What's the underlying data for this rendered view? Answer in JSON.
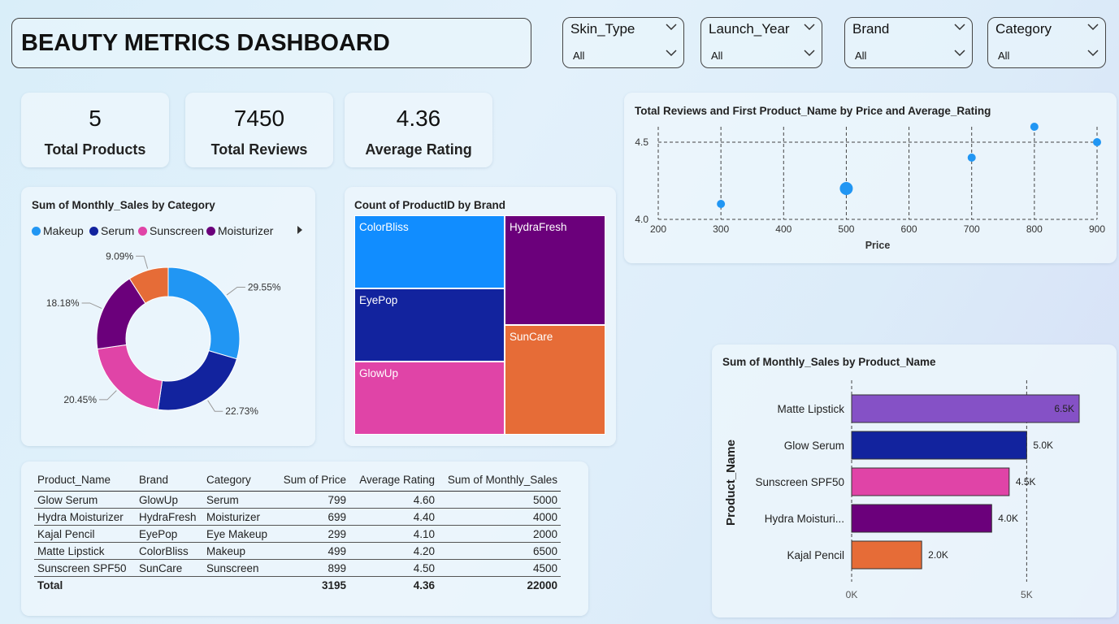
{
  "header": {
    "title": "BEAUTY METRICS DASHBOARD"
  },
  "slicers": [
    {
      "label": "Skin_Type",
      "value": "All"
    },
    {
      "label": "Launch_Year",
      "value": "All"
    },
    {
      "label": "Brand",
      "value": "All"
    },
    {
      "label": "Category",
      "value": "All"
    }
  ],
  "kpis": [
    {
      "value": "5",
      "caption": "Total Products"
    },
    {
      "value": "7450",
      "caption": "Total Reviews"
    },
    {
      "value": "4.36",
      "caption": "Average Rating"
    }
  ],
  "donut": {
    "title": "Sum of Monthly_Sales by Category"
  },
  "treemap": {
    "title": "Count of ProductID by Brand"
  },
  "scatter": {
    "title": "Total Reviews and First Product_Name by Price and Average_Rating"
  },
  "bars": {
    "title": "Sum of Monthly_Sales by Product_Name"
  },
  "table": {
    "columns": [
      "Product_Name",
      "Brand",
      "Category",
      "Sum of Price",
      "Average Rating",
      "Sum of Monthly_Sales"
    ],
    "rows": [
      [
        "Glow Serum",
        "GlowUp",
        "Serum",
        "799",
        "4.60",
        "5000"
      ],
      [
        "Hydra Moisturizer",
        "HydraFresh",
        "Moisturizer",
        "699",
        "4.40",
        "4000"
      ],
      [
        "Kajal Pencil",
        "EyePop",
        "Eye Makeup",
        "299",
        "4.10",
        "2000"
      ],
      [
        "Matte Lipstick",
        "ColorBliss",
        "Makeup",
        "499",
        "4.20",
        "6500"
      ],
      [
        "Sunscreen SPF50",
        "SunCare",
        "Sunscreen",
        "899",
        "4.50",
        "4500"
      ]
    ],
    "total": [
      "Total",
      "",
      "",
      "3195",
      "4.36",
      "22000"
    ]
  },
  "chart_data": [
    {
      "type": "pie",
      "title": "Sum of Monthly_Sales by Category",
      "legend_position": "top-left",
      "categories": [
        "Makeup",
        "Serum",
        "Sunscreen",
        "Moisturizer",
        "Eye Makeup"
      ],
      "values": [
        29.55,
        22.73,
        20.45,
        18.18,
        9.09
      ],
      "labels": [
        "29.55%",
        "22.73%",
        "20.45%",
        "18.18%",
        "9.09%"
      ],
      "colors": [
        "#2196f3",
        "#12239e",
        "#e044a7",
        "#6b007b",
        "#e66c37"
      ],
      "legend": [
        "Makeup",
        "Serum",
        "Sunscreen",
        "Moisturizer"
      ]
    },
    {
      "type": "treemap",
      "title": "Count of ProductID by Brand",
      "categories": [
        "ColorBliss",
        "HydraFresh",
        "EyePop",
        "SunCare",
        "GlowUp"
      ],
      "values": [
        1,
        1,
        1,
        1,
        1
      ],
      "colors": [
        "#118dff",
        "#6b007b",
        "#12239e",
        "#e66c37",
        "#e044a7"
      ]
    },
    {
      "type": "scatter",
      "title": "Total Reviews and First Product_Name by Price and Average_Rating",
      "xlabel": "Price",
      "ylabel": "",
      "xlim": [
        200,
        900
      ],
      "ylim": [
        4.0,
        4.6
      ],
      "xticks": [
        "200",
        "300",
        "400",
        "500",
        "600",
        "700",
        "800",
        "900"
      ],
      "yticks": [
        "4.0",
        "4.5"
      ],
      "points": [
        {
          "x": 300,
          "y": 4.1
        },
        {
          "x": 500,
          "y": 4.2
        },
        {
          "x": 700,
          "y": 4.4
        },
        {
          "x": 800,
          "y": 4.6
        },
        {
          "x": 900,
          "y": 4.5
        }
      ],
      "color": "#2196f3"
    },
    {
      "type": "bar",
      "orientation": "horizontal",
      "title": "Sum of Monthly_Sales by Product_Name",
      "ylabel": "Product_Name",
      "categories": [
        "Matte Lipstick",
        "Glow Serum",
        "Sunscreen SPF50",
        "Hydra Moisturi...",
        "Kajal Pencil"
      ],
      "values": [
        6500,
        5000,
        4500,
        4000,
        2000
      ],
      "labels": [
        "6.5K",
        "5.0K",
        "4.5K",
        "4.0K",
        "2.0K"
      ],
      "xticks": [
        "0K",
        "5K"
      ],
      "xlim": [
        0,
        6500
      ],
      "colors": [
        "#8551c6",
        "#12239e",
        "#e044a7",
        "#6b007b",
        "#e66c37"
      ]
    }
  ]
}
